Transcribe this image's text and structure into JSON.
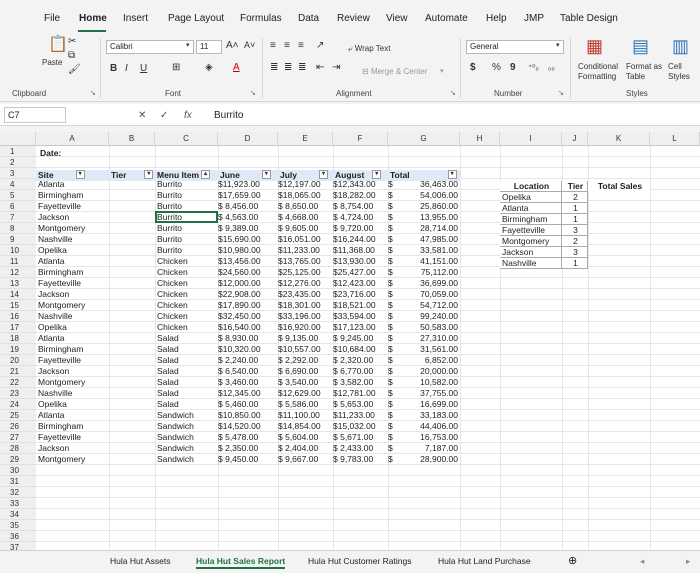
{
  "tabs": [
    "File",
    "Home",
    "Insert",
    "Page Layout",
    "Formulas",
    "Data",
    "Review",
    "View",
    "Automate",
    "Help",
    "JMP",
    "Table Design"
  ],
  "ribbon": {
    "paste": "Paste",
    "font_name": "Calibri",
    "font_size": "11",
    "grow": "A^",
    "shrink": "A^",
    "bold": "B",
    "italic": "I",
    "underline": "U",
    "wrap_text": "Wrap Text",
    "merge_center": "Merge & Center",
    "number_format": "General",
    "currency": "$",
    "percent": "%",
    "comma": "9",
    "cond_format": "Conditional Formatting",
    "format_table": "Format as Table",
    "cell_styles": "Cell Styles",
    "groups": {
      "clipboard": "Clipboard",
      "font": "Font",
      "alignment": "Alignment",
      "number": "Number",
      "styles": "Styles"
    }
  },
  "formula_bar": {
    "name_box": "C7",
    "content": "Burrito",
    "fx": "fx"
  },
  "columns": [
    "A",
    "B",
    "C",
    "D",
    "E",
    "F",
    "G",
    "H",
    "I",
    "J",
    "K",
    "L"
  ],
  "row1_label": "Date:",
  "table_header": {
    "site": "Site",
    "tier": "Tier",
    "menu": "Menu Item",
    "june": "June",
    "july": "July",
    "august": "August",
    "total": "Total"
  },
  "rows": [
    [
      "Atlanta",
      "Burrito",
      "$11,923.00",
      "$12,197.00",
      "$12,343.00",
      "$",
      "36,463.00"
    ],
    [
      "Birmingham",
      "Burrito",
      "$17,659.00",
      "$18,065.00",
      "$18,282.00",
      "$",
      "54,006.00"
    ],
    [
      "Fayetteville",
      "Burrito",
      "$ 8,456.00",
      "$ 8,650.00",
      "$ 8,754.00",
      "$",
      "25,860.00"
    ],
    [
      "Jackson",
      "Burrito",
      "$ 4,563.00",
      "$ 4,668.00",
      "$ 4,724.00",
      "$",
      "13,955.00"
    ],
    [
      "Montgomery",
      "Burrito",
      "$ 9,389.00",
      "$ 9,605.00",
      "$ 9,720.00",
      "$",
      "28,714.00"
    ],
    [
      "Nashville",
      "Burrito",
      "$15,690.00",
      "$16,051.00",
      "$16,244.00",
      "$",
      "47,985.00"
    ],
    [
      "Opelika",
      "Burrito",
      "$10,980.00",
      "$11,233.00",
      "$11,368.00",
      "$",
      "33,581.00"
    ],
    [
      "Atlanta",
      "Chicken",
      "$13,456.00",
      "$13,765.00",
      "$13,930.00",
      "$",
      "41,151.00"
    ],
    [
      "Birmingham",
      "Chicken",
      "$24,560.00",
      "$25,125.00",
      "$25,427.00",
      "$",
      "75,112.00"
    ],
    [
      "Fayetteville",
      "Chicken",
      "$12,000.00",
      "$12,276.00",
      "$12,423.00",
      "$",
      "36,699.00"
    ],
    [
      "Jackson",
      "Chicken",
      "$22,908.00",
      "$23,435.00",
      "$23,716.00",
      "$",
      "70,059.00"
    ],
    [
      "Montgomery",
      "Chicken",
      "$17,890.00",
      "$18,301.00",
      "$18,521.00",
      "$",
      "54,712.00"
    ],
    [
      "Nashville",
      "Chicken",
      "$32,450.00",
      "$33,196.00",
      "$33,594.00",
      "$",
      "99,240.00"
    ],
    [
      "Opelika",
      "Chicken",
      "$16,540.00",
      "$16,920.00",
      "$17,123.00",
      "$",
      "50,583.00"
    ],
    [
      "Atlanta",
      "Salad",
      "$ 8,930.00",
      "$ 9,135.00",
      "$ 9,245.00",
      "$",
      "27,310.00"
    ],
    [
      "Birmingham",
      "Salad",
      "$10,320.00",
      "$10,557.00",
      "$10,684.00",
      "$",
      "31,561.00"
    ],
    [
      "Fayetteville",
      "Salad",
      "$ 2,240.00",
      "$ 2,292.00",
      "$ 2,320.00",
      "$",
      "6,852.00"
    ],
    [
      "Jackson",
      "Salad",
      "$ 6,540.00",
      "$ 6,690.00",
      "$ 6,770.00",
      "$",
      "20,000.00"
    ],
    [
      "Montgomery",
      "Salad",
      "$ 3,460.00",
      "$ 3,540.00",
      "$ 3,582.00",
      "$",
      "10,582.00"
    ],
    [
      "Nashville",
      "Salad",
      "$12,345.00",
      "$12,629.00",
      "$12,781.00",
      "$",
      "37,755.00"
    ],
    [
      "Opelika",
      "Salad",
      "$ 5,460.00",
      "$ 5,586.00",
      "$ 5,653.00",
      "$",
      "16,699.00"
    ],
    [
      "Atlanta",
      "Sandwich",
      "$10,850.00",
      "$11,100.00",
      "$11,233.00",
      "$",
      "33,183.00"
    ],
    [
      "Birmingham",
      "Sandwich",
      "$14,520.00",
      "$14,854.00",
      "$15,032.00",
      "$",
      "44,406.00"
    ],
    [
      "Fayetteville",
      "Sandwich",
      "$ 5,478.00",
      "$ 5,604.00",
      "$ 5,671.00",
      "$",
      "16,753.00"
    ],
    [
      "Jackson",
      "Sandwich",
      "$ 2,350.00",
      "$ 2,404.00",
      "$ 2,433.00",
      "$",
      "7,187.00"
    ],
    [
      "Montgomery",
      "Sandwich",
      "$ 9,450.00",
      "$ 9,667.00",
      "$ 9,783.00",
      "$",
      "28,900.00"
    ]
  ],
  "lookup": {
    "header": {
      "location": "Location",
      "tier": "Tier",
      "total": "Total Sales"
    },
    "rows": [
      [
        "Opelika",
        "2"
      ],
      [
        "Atlanta",
        "1"
      ],
      [
        "Birmingham",
        "1"
      ],
      [
        "Fayetteville",
        "3"
      ],
      [
        "Montgomery",
        "2"
      ],
      [
        "Jackson",
        "3"
      ],
      [
        "Nashville",
        "1"
      ]
    ]
  },
  "sheets": [
    "Hula Hut Assets",
    "Hula Hut Sales Report",
    "Hula Hut Customer Ratings",
    "Hula Hut Land Purchase"
  ],
  "active_sheet": "Hula Hut Sales Report",
  "colors": {
    "accent": "#1e7145",
    "header_fill": "#dfe9f7"
  }
}
